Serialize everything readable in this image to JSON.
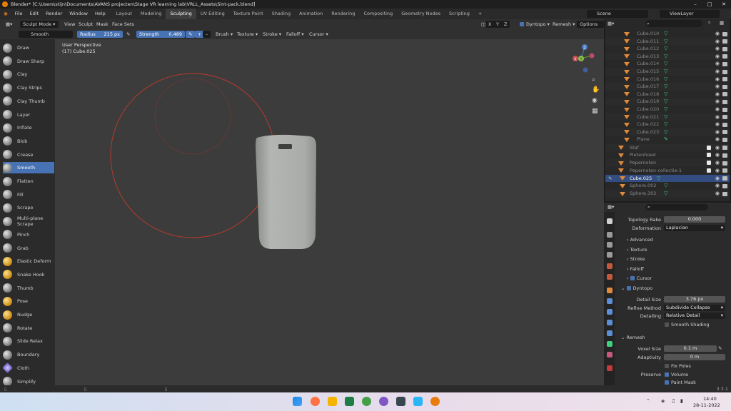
{
  "window": {
    "title": "Blender* [C:\\Users\\stijn\\Documents\\AVANS projecten\\Stage VR learning lab\\VRLL_Assets\\Sint-pack.blend]"
  },
  "menu": [
    "File",
    "Edit",
    "Render",
    "Window",
    "Help"
  ],
  "workspaces": [
    "Layout",
    "Modeling",
    "Sculpting",
    "UV Editing",
    "Texture Paint",
    "Shading",
    "Animation",
    "Rendering",
    "Compositing",
    "Geometry Nodes",
    "Scripting"
  ],
  "active_workspace": "Sculpting",
  "scene": "Scene",
  "view_layer": "ViewLayer",
  "header": {
    "mode": "Sculpt Mode",
    "menus": [
      "View",
      "Sculpt",
      "Mask",
      "Face Sets"
    ],
    "axes": [
      "X",
      "Y",
      "Z"
    ],
    "dyntopo": "Dyntopo",
    "remesh": "Remesh",
    "options": "Options"
  },
  "brush_bar": {
    "brush_name": "Smooth",
    "radius_label": "Radius",
    "radius_value": "215 px",
    "strength_label": "Strength",
    "strength_value": "0.489",
    "menus": [
      "Brush",
      "Texture",
      "Stroke",
      "Falloff",
      "Cursor"
    ]
  },
  "tools": [
    "Draw",
    "Draw Sharp",
    "Clay",
    "Clay Strips",
    "Clay Thumb",
    "Layer",
    "Inflate",
    "Blob",
    "Crease",
    "Smooth",
    "Flatten",
    "Fill",
    "Scrape",
    "Multi-plane Scrape",
    "Pinch",
    "Grab",
    "Elastic Deform",
    "Snake Hook",
    "Thumb",
    "Pose",
    "Nudge",
    "Rotate",
    "Slide Relax",
    "Boundary",
    "Cloth",
    "Simplify"
  ],
  "active_tool": "Smooth",
  "viewport": {
    "perspective": "User Perspective",
    "object": "(17) Cube.025"
  },
  "gizmo": {
    "x": "X",
    "y": "Y",
    "z": "Z"
  },
  "outliner": {
    "search_placeholder": "",
    "items": [
      "Cube.010",
      "Cube.011",
      "Cube.012",
      "Cube.013",
      "Cube.014",
      "Cube.015",
      "Cube.016",
      "Cube.017",
      "Cube.018",
      "Cube.019",
      "Cube.020",
      "Cube.021",
      "Cube.022",
      "Cube.023",
      "Plane"
    ],
    "collections": [
      "Staf",
      "Pietenhoed",
      "Pepernoten",
      "Pepernoten-collectie-1"
    ],
    "selected": "Cube.025",
    "after": [
      "Sphere.002",
      "Sphere.302"
    ]
  },
  "properties": {
    "topology_rake_label": "Topology Rake",
    "topology_rake_value": "0.000",
    "deformation_label": "Deformation",
    "deformation_value": "Laplacian",
    "sections": [
      "Advanced",
      "Texture",
      "Stroke",
      "Falloff",
      "Cursor"
    ],
    "dyntopo_label": "Dyntopo",
    "detail_size_label": "Detail Size",
    "detail_size_value": "3.76 px",
    "refine_method_label": "Refine Method",
    "refine_method_value": "Subdivide Collapse",
    "detailing_label": "Detailing",
    "detailing_value": "Relative Detail",
    "smooth_shading_label": "Smooth Shading",
    "remesh_label": "Remesh",
    "voxel_size_label": "Voxel Size",
    "voxel_size_value": "0.1 m",
    "adaptivity_label": "Adaptivity",
    "adaptivity_value": "0 m",
    "fix_poles_label": "Fix Poles",
    "preserve_label": "Preserve",
    "volume_label": "Volume",
    "paint_mask_label": "Paint Mask"
  },
  "status": {
    "version": "3.3.1"
  },
  "taskbar": {
    "time": "14:40",
    "date": "28-11-2022"
  },
  "colors": {
    "accent": "#4772b3",
    "brush_ring": "#c03a2b",
    "object_tri": "#e08a3a"
  }
}
